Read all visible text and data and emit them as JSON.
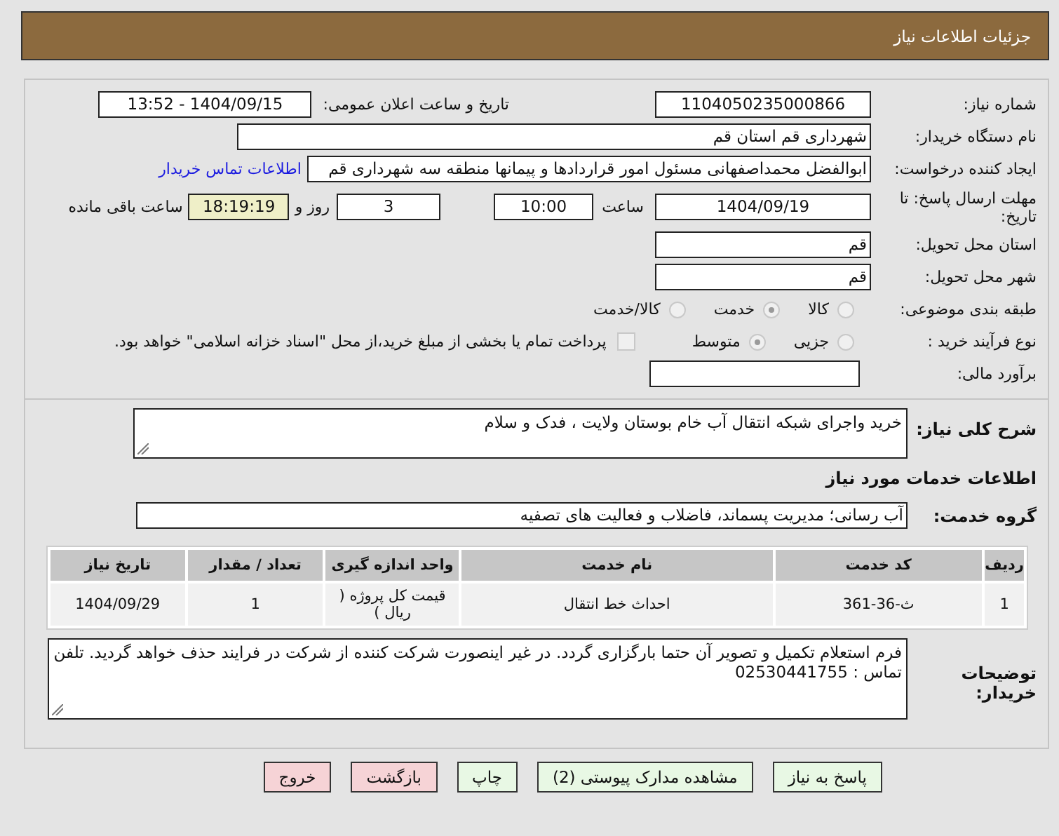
{
  "header": {
    "title": "جزئیات اطلاعات نیاز"
  },
  "need_number": {
    "label": "شماره نیاز:",
    "value": "1104050235000866"
  },
  "announce_date": {
    "label": "تاریخ و ساعت اعلان عمومی:",
    "value": "1404/09/15 - 13:52"
  },
  "buyer_org": {
    "label": "نام دستگاه خریدار:",
    "value": "شهرداری قم استان قم"
  },
  "requester": {
    "label": "ایجاد کننده درخواست:",
    "value": "ابوالفضل محمداصفهانی مسئول امور قراردادها و پیمانها منطقه سه شهرداری قم",
    "link": "اطلاعات تماس خریدار"
  },
  "deadline": {
    "label": "مهلت ارسال پاسخ: تا تاریخ:",
    "date": "1404/09/19",
    "time_label": "ساعت",
    "time": "10:00",
    "days": "3",
    "days_label": "روز و",
    "remaining": "18:19:19",
    "remaining_label": "ساعت باقی مانده"
  },
  "province": {
    "label": "استان محل تحویل:",
    "value": "قم"
  },
  "city": {
    "label": "شهر محل تحویل:",
    "value": "قم"
  },
  "category": {
    "label": "طبقه بندی موضوعی:",
    "options": [
      {
        "label": "کالا",
        "selected": false
      },
      {
        "label": "خدمت",
        "selected": true
      },
      {
        "label": "کالا/خدمت",
        "selected": false
      }
    ]
  },
  "process": {
    "label": "نوع فرآیند خرید :",
    "options": [
      {
        "label": "جزیی",
        "selected": false
      },
      {
        "label": "متوسط",
        "selected": true
      }
    ],
    "treasury": {
      "checked": false,
      "text": "پرداخت تمام یا بخشی از مبلغ خرید،از محل \"اسناد خزانه اسلامی\" خواهد بود."
    }
  },
  "estimate": {
    "label": "برآورد مالی:"
  },
  "description": {
    "label": "شرح کلی نیاز:",
    "value": "خرید واجرای شبکه انتقال آب خام بوستان ولایت ، فدک و سلام"
  },
  "services_heading": "اطلاعات خدمات مورد نیاز",
  "service_group": {
    "label": "گروه خدمت:",
    "value": "آب رسانی؛ مدیریت پسماند، فاضلاب و فعالیت های تصفیه"
  },
  "table": {
    "columns": [
      "ردیف",
      "کد خدمت",
      "نام خدمت",
      "واحد اندازه گیری",
      "تعداد / مقدار",
      "تاریخ نیاز"
    ],
    "rows": [
      [
        "1",
        "ث-36-361",
        "احداث خط انتقال",
        "قیمت کل پروژه ( ریال )",
        "1",
        "1404/09/29"
      ]
    ]
  },
  "buyer_notes": {
    "label": "توضیحات خریدار:",
    "value": "فرم استعلام تکمیل و تصویر آن حتما بارگزاری گردد. در غیر اینصورت شرکت کننده از شرکت در فرایند حذف خواهد گردید. تلفن تماس : 02530441755"
  },
  "buttons": [
    {
      "label": "پاسخ به نیاز",
      "kind": "action"
    },
    {
      "label": "مشاهده مدارک پیوستی (2)",
      "kind": "action"
    },
    {
      "label": "چاپ",
      "kind": "action"
    },
    {
      "label": "بازگشت",
      "kind": "leave"
    },
    {
      "label": "خروج",
      "kind": "leave"
    }
  ]
}
